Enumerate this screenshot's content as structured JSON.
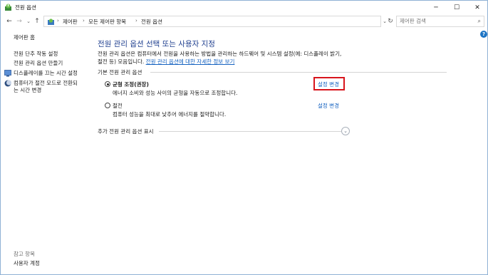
{
  "window": {
    "title": "전원 옵션",
    "controls": {
      "minimize": "─",
      "maximize": "☐",
      "close": "✕"
    }
  },
  "nav": {
    "back": "←",
    "forward": "→",
    "recent": "⌄",
    "up": "↑",
    "breadcrumb": [
      "제어판",
      "모든 제어판 항목",
      "전원 옵션"
    ],
    "separator": "›",
    "dropdown": "⌄",
    "refresh": "↻",
    "search_placeholder": "제어판 검색",
    "search_icon": "⌕"
  },
  "help_icon": "?",
  "sidebar": {
    "home": "제어판 홈",
    "links": [
      {
        "label": "전원 단추 작동 설정",
        "shield": false
      },
      {
        "label": "전원 관리 옵션 만들기",
        "shield": false
      },
      {
        "label": "디스플레이를 끄는 시간 설정",
        "shield": true
      },
      {
        "label": "컴퓨터가 절전 모드로 전환되",
        "label2": "는 시간 변경",
        "shield": false
      }
    ],
    "see_also": "참고 항목",
    "user_accounts": "사용자 계정"
  },
  "main": {
    "title": "전원 관리 옵션 선택 또는 사용자 지정",
    "description_line1": "전원 관리 옵션은 컴퓨터에서 전원을 사용하는 방법을 관리하는 하드웨어 및 시스템 설정(예: 디스플레이 밝기,",
    "description_line2_prefix": "절전 등) 모음입니다.",
    "description_link": "전원 관리 옵션에 대한 자세한 정보 보기",
    "group_label": "기본 전원 관리 옵션",
    "plans": [
      {
        "name": "균형 조정(권장)",
        "description": "에너지 소비와 성능 사이의 균형을 자동으로 조정합니다.",
        "selected": true,
        "change_label": "설정 변경"
      },
      {
        "name": "절전",
        "description": "컴퓨터 성능을 최대로 낮추어 에너지를 절약합니다.",
        "selected": false,
        "change_label": "설정 변경"
      }
    ],
    "more_plans_label": "추가 전원 관리 옵션 표시",
    "expand_icon": "⌄"
  },
  "colors": {
    "title_blue": "#1f3f8f",
    "link_blue": "#1562c0",
    "highlight_red": "#d8141c"
  }
}
